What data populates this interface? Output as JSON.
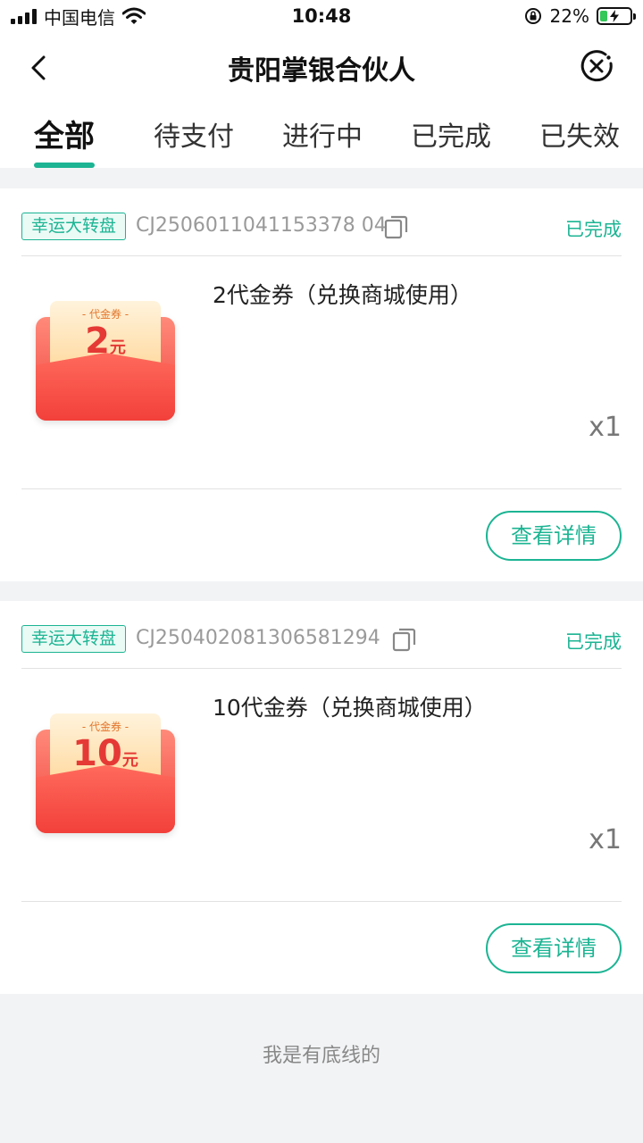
{
  "status_bar": {
    "carrier": "中国电信",
    "time": "10:48",
    "battery_percent": "22%"
  },
  "header": {
    "title": "贵阳掌银合伙人",
    "back_icon": "chevron-left-icon",
    "close_icon": "close-circle-icon"
  },
  "tabs": [
    {
      "label": "全部",
      "active": true
    },
    {
      "label": "待支付",
      "active": false
    },
    {
      "label": "进行中",
      "active": false
    },
    {
      "label": "已完成",
      "active": false
    },
    {
      "label": "已失效",
      "active": false
    }
  ],
  "orders": [
    {
      "tag": "幸运大转盘",
      "order_no": "CJ2506011041153378 04",
      "status": "已完成",
      "coupon_label": "- 代金券 -",
      "coupon_value": "2",
      "coupon_unit": "元",
      "item_name": "2代金券（兑换商城使用）",
      "quantity": "x1",
      "detail_button": "查看详情"
    },
    {
      "tag": "幸运大转盘",
      "order_no": "CJ250402081306581294",
      "status": "已完成",
      "coupon_label": "- 代金券 -",
      "coupon_value": "10",
      "coupon_unit": "元",
      "item_name": "10代金券（兑换商城使用）",
      "quantity": "x1",
      "detail_button": "查看详情"
    }
  ],
  "footer": {
    "text": "我是有底线的"
  },
  "colors": {
    "accent": "#1cb493",
    "coupon_red": "#e53935"
  }
}
